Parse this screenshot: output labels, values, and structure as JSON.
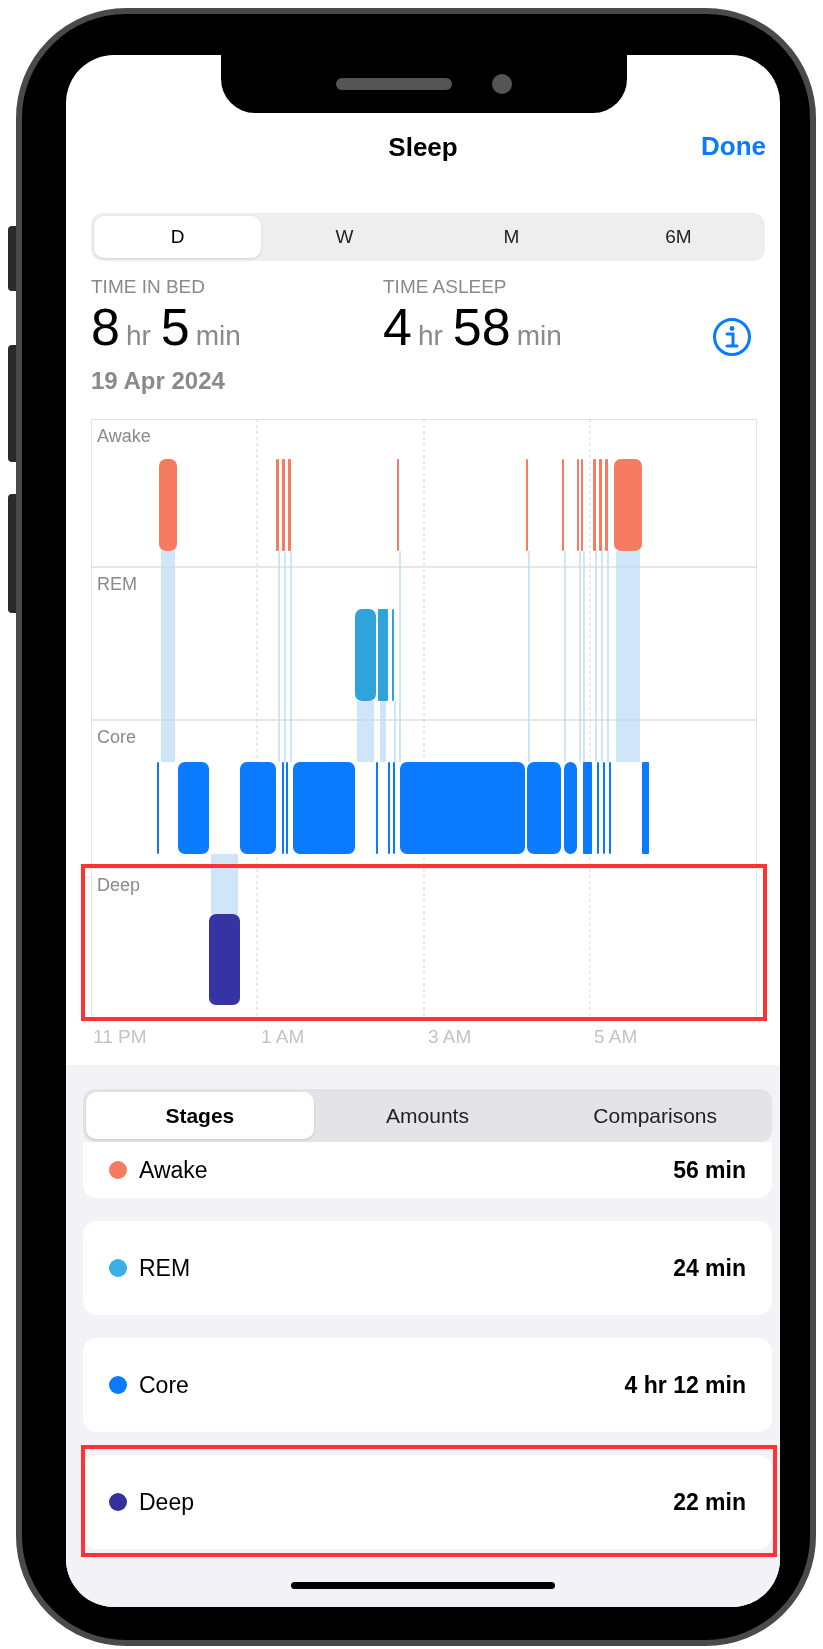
{
  "header": {
    "title": "Sleep",
    "done": "Done"
  },
  "range_tabs": [
    {
      "label": "D",
      "selected": true
    },
    {
      "label": "W",
      "selected": false
    },
    {
      "label": "M",
      "selected": false
    },
    {
      "label": "6M",
      "selected": false
    }
  ],
  "summary": [
    {
      "label": "TIME IN BED",
      "parts": [
        {
          "kind": "number",
          "text": "8"
        },
        {
          "kind": "unit",
          "text": "hr"
        },
        {
          "kind": "number",
          "text": "5"
        },
        {
          "kind": "unit",
          "text": "min"
        }
      ]
    },
    {
      "label": "TIME ASLEEP",
      "parts": [
        {
          "kind": "number",
          "text": "4"
        },
        {
          "kind": "unit",
          "text": "hr"
        },
        {
          "kind": "number",
          "text": "58"
        },
        {
          "kind": "unit",
          "text": "min"
        }
      ]
    }
  ],
  "date": "19 Apr 2024",
  "chart": {
    "stages": [
      {
        "name": "Awake",
        "color": "#f77b61",
        "highlighted": false
      },
      {
        "name": "REM",
        "color": "#2fa4dc",
        "highlighted": false
      },
      {
        "name": "Core",
        "color": "#0a7aff",
        "highlighted": false
      },
      {
        "name": "Deep",
        "color": "#3633a3",
        "highlighted": true
      }
    ],
    "time_labels": [
      "11 PM",
      "1 AM",
      "3 AM",
      "5 AM"
    ]
  },
  "view_tabs": [
    {
      "label": "Stages",
      "selected": true
    },
    {
      "label": "Amounts",
      "selected": false
    },
    {
      "label": "Comparisons",
      "selected": false
    }
  ],
  "stage_rows": [
    {
      "name": "Awake",
      "value": "56 min",
      "color": "#f77b61",
      "highlighted": false
    },
    {
      "name": "REM",
      "value": "24 min",
      "color": "#3aaee6",
      "highlighted": false
    },
    {
      "name": "Core",
      "value": "4 hr 12 min",
      "color": "#0a7aff",
      "highlighted": false
    },
    {
      "name": "Deep",
      "value": "22 min",
      "color": "#34309c",
      "highlighted": true
    }
  ]
}
